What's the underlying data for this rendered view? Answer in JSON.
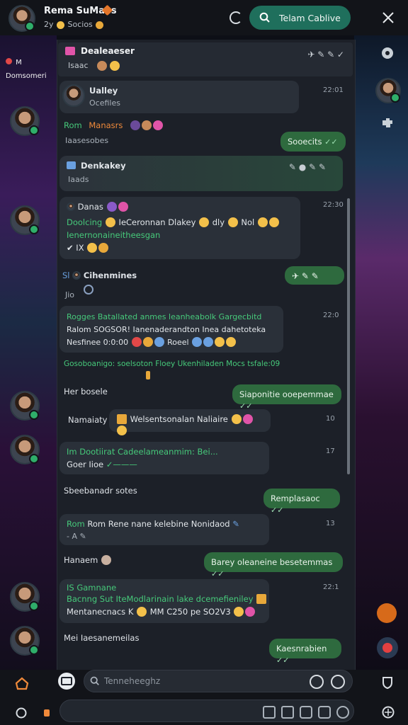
{
  "header": {
    "name": "Rema SuMaes",
    "status": "2y",
    "status_extra": "Socios",
    "cta_label": "Telam Cablive"
  },
  "left_overlay": {
    "label": "M Domsomeri"
  },
  "top_pinned": {
    "title": "Dealeaeser",
    "sub": "Isaac"
  },
  "messages": [
    {
      "id": "m1",
      "title": "Ualley",
      "sub": "Ocefiles",
      "time": "22:01"
    },
    {
      "id": "m2",
      "label_a": "Rom",
      "label_b": "Manasrs",
      "sub": "Iaasesobes"
    },
    {
      "id": "m3",
      "text": "Sooecits"
    },
    {
      "id": "m4",
      "title": "Denkakey",
      "sub": "Iaads"
    },
    {
      "id": "m5",
      "header": "Danas",
      "line1": "Doolcing",
      "line1b": "IeCeronnan Dlakey",
      "line1c": "dly",
      "line1d": "Nol",
      "line2": "Ienernonaineitheesgan",
      "line3": "IX",
      "time": "22:30"
    },
    {
      "id": "m6",
      "label": "Cihenmines",
      "sub": "Jio"
    },
    {
      "id": "m7",
      "line1": "Rogges Batallated anmes leanheabolk Gargecbitd",
      "line2": "Ralom SOGSOR!  Ianenaderandton Inea dahetoteka",
      "line3": "Nesfinee 0:0:00",
      "line3b": "Roeel",
      "time": "22:0"
    },
    {
      "id": "m8",
      "text": "Gosoboanigo: soelsoton Floey Ukenhiladen Mocs tsfale:09"
    },
    {
      "id": "m9",
      "label": "Her bosele",
      "out": "Siaponitie ooepemmae"
    },
    {
      "id": "m10",
      "label": "Namaiaty",
      "text": "Welsentsonalan Naliaire",
      "time": "10"
    },
    {
      "id": "m11",
      "line1": "Im Dootiirat Cadeelameanmim: Bei...",
      "line2": "Goer Iioe",
      "time": "17"
    },
    {
      "id": "m12",
      "label": "Sbeebanadr sotes",
      "out": "Remplasaoc"
    },
    {
      "id": "m13",
      "line1": "Rom Rene nane kelebine Nonidaod",
      "line2": "- A",
      "time": "13"
    },
    {
      "id": "m14",
      "label": "Hanaem",
      "out": "Barey oleaneine besetemmas"
    },
    {
      "id": "m15",
      "line1": "IS Gamnane",
      "line2": "Bacnng Sut IteModlarinain lake dcemefieniley",
      "line3": "Mentanecnacs K",
      "line3b": "MM C250 pe SO2V3",
      "time": "22:1"
    },
    {
      "id": "m16",
      "label": "Mei Iaesanemeilas",
      "out": "Kaesnrabien"
    }
  ],
  "input": {
    "placeholder": "Tenneheeghz"
  },
  "colors": {
    "accent": "#1f6f5c",
    "outgoing": "#2e6a3e",
    "incoming": "#2c323b",
    "online": "#2fae6a"
  }
}
